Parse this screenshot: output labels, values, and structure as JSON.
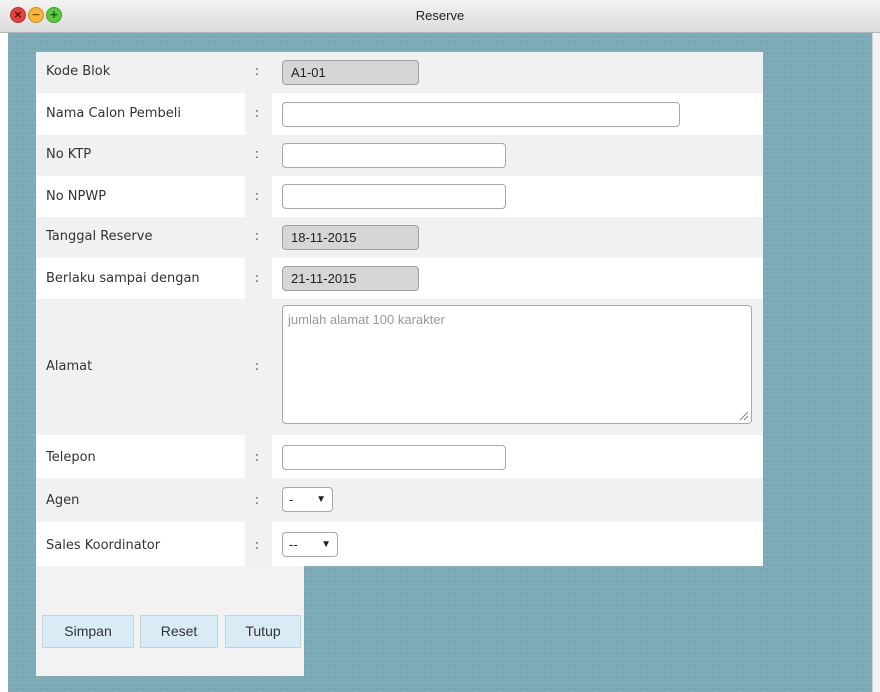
{
  "window": {
    "title": "Reserve"
  },
  "form": {
    "rows": [
      {
        "label": "Kode Blok",
        "colon": ":",
        "value": "A1-01"
      },
      {
        "label": "Nama Calon Pembeli",
        "colon": ":",
        "value": ""
      },
      {
        "label": "No KTP",
        "colon": ":",
        "value": ""
      },
      {
        "label": "No NPWP",
        "colon": ":",
        "value": ""
      },
      {
        "label": "Tanggal Reserve",
        "colon": ":",
        "value": "18-11-2015"
      },
      {
        "label": "Berlaku sampai dengan",
        "colon": ":",
        "value": "21-11-2015"
      },
      {
        "label": "Alamat",
        "colon": ":",
        "value": "",
        "placeholder": "jumlah alamat 100 karakter"
      },
      {
        "label": "Telepon",
        "colon": ":",
        "value": ""
      },
      {
        "label": "Agen",
        "colon": ":",
        "value": "-"
      },
      {
        "label": "Sales Koordinator",
        "colon": ":",
        "value": "--"
      }
    ]
  },
  "buttons": {
    "save": "Simpan",
    "reset": "Reset",
    "close": "Tutup"
  },
  "icons": {
    "close": "close-icon",
    "minimize": "minimize-icon",
    "maximize": "maximize-icon",
    "dropdown": "chevron-down-icon"
  },
  "colors": {
    "background": "#7ca9b6",
    "button": "#d9ecf6",
    "readonly_input": "#d6d6d6"
  }
}
